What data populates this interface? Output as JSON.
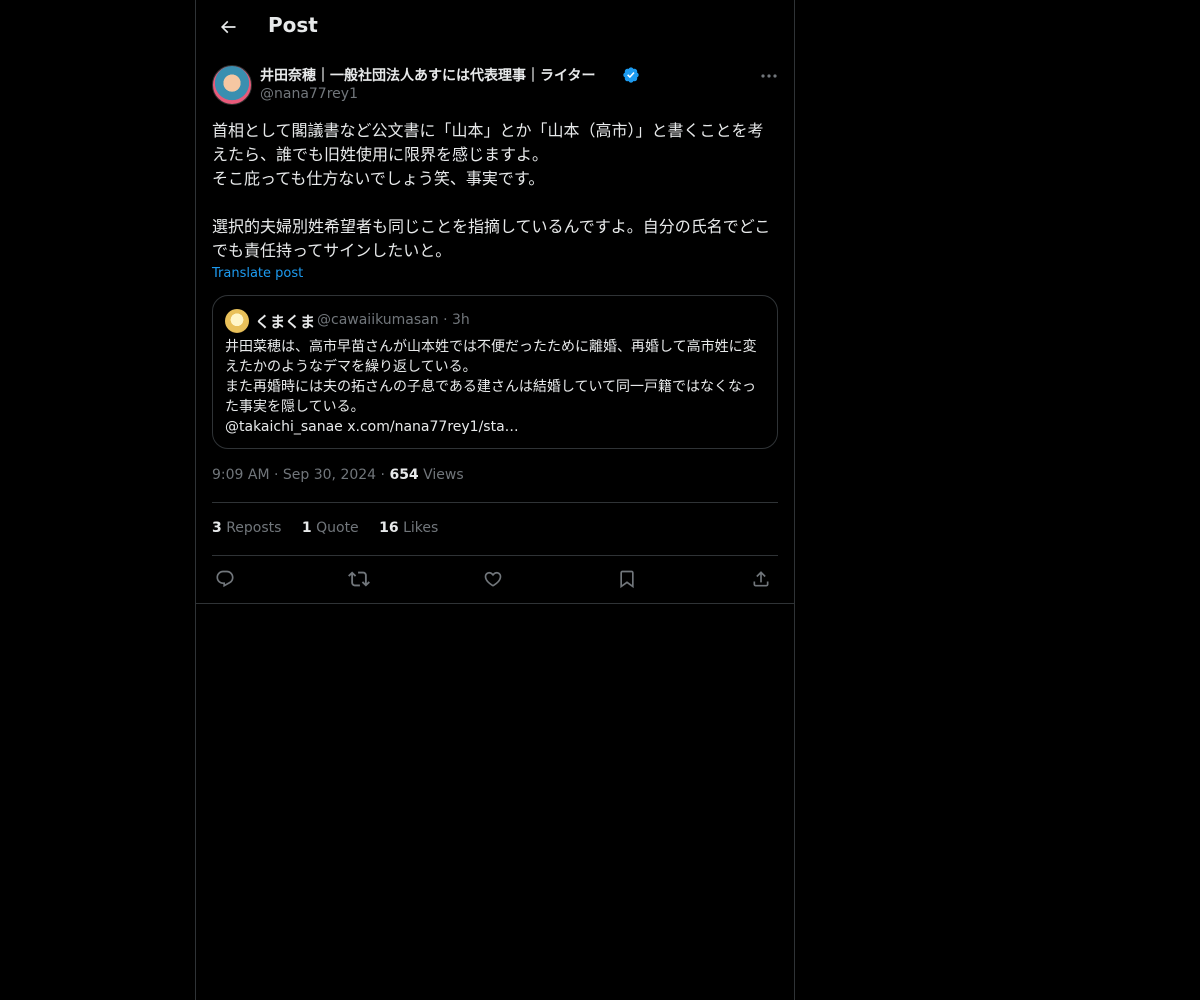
{
  "header": {
    "title": "Post"
  },
  "author": {
    "name": "井田奈穂｜一般社団法人あすには代表理事｜ライター",
    "handle": "@nana77rey1"
  },
  "post": {
    "lines_1": "首相として閣議書など公文書に「山本」とか「山本（高市）」と書くことを考えたら、誰でも旧姓使用に限界を感じますよ。",
    "lines_2": "そこ庇っても仕方ないでしょう笑、事実です。",
    "lines_3": "選択的夫婦別姓希望者も同じことを指摘しているんですよ。自分の氏名でどこでも責任持ってサインしたいと。",
    "translate_label": "Translate post"
  },
  "quote": {
    "name": "くまくま",
    "handle": "@cawaiikumasan",
    "time": "· 3h",
    "line_1": "井田菜穂は、高市早苗さんが山本姓では不便だったために離婚、再婚して高市姓に変えたかのようなデマを繰り返している。",
    "line_2": "また再婚時には夫の拓さんの子息である建さんは結婚していて同一戸籍ではなくなった事実を隠している。",
    "line_3": "@takaichi_sanae x.com/nana77rey1/sta…"
  },
  "meta": {
    "time": "9:09 AM",
    "sep1": "·",
    "date": "Sep 30, 2024",
    "sep2": "·",
    "views_count": "654",
    "views_label": "Views"
  },
  "stats": {
    "reposts_count": "3",
    "reposts_label": "Reposts",
    "quotes_count": "1",
    "quotes_label": "Quote",
    "likes_count": "16",
    "likes_label": "Likes"
  },
  "icons": {
    "back": "arrow-left-icon",
    "verified": "verified-badge-icon",
    "more": "more-dots-icon",
    "reply": "reply-icon",
    "repost": "repost-icon",
    "like": "heart-icon",
    "bookmark": "bookmark-icon",
    "share": "share-icon"
  },
  "colors": {
    "background": "#000000",
    "text": "#e7e9ea",
    "secondary": "#71767b",
    "accent": "#1d9bf0",
    "border": "#2f3336"
  }
}
